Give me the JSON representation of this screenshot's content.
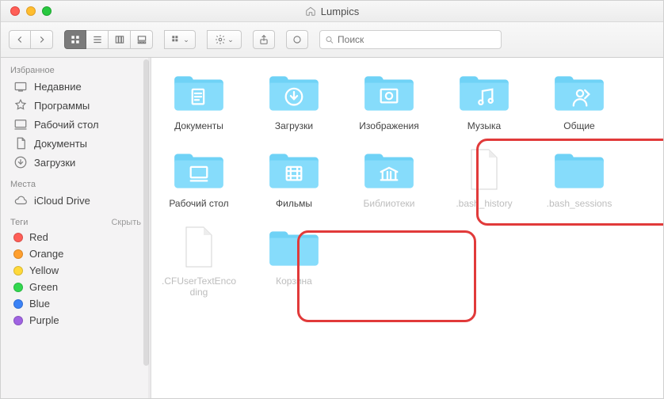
{
  "window": {
    "title": "Lumpics"
  },
  "search": {
    "placeholder": "Поиск"
  },
  "sidebar": {
    "favorites_header": "Избранное",
    "locations_header": "Места",
    "tags_header": "Теги",
    "hide_label": "Скрыть",
    "favorites": [
      {
        "label": "Недавние",
        "icon": "recent"
      },
      {
        "label": "Программы",
        "icon": "apps"
      },
      {
        "label": "Рабочий стол",
        "icon": "desktop"
      },
      {
        "label": "Документы",
        "icon": "docs"
      },
      {
        "label": "Загрузки",
        "icon": "downloads"
      }
    ],
    "locations": [
      {
        "label": "iCloud Drive",
        "icon": "cloud"
      }
    ],
    "tags": [
      {
        "label": "Red",
        "color": "#ff5e57"
      },
      {
        "label": "Orange",
        "color": "#ff9f2e"
      },
      {
        "label": "Yellow",
        "color": "#ffd93a"
      },
      {
        "label": "Green",
        "color": "#32d84f"
      },
      {
        "label": "Blue",
        "color": "#3b82f6"
      },
      {
        "label": "Purple",
        "color": "#a063e2"
      }
    ]
  },
  "items": [
    {
      "label": "Документы",
      "type": "folder",
      "glyph": "doc",
      "hidden": false
    },
    {
      "label": "Загрузки",
      "type": "folder",
      "glyph": "down",
      "hidden": false
    },
    {
      "label": "Изображения",
      "type": "folder",
      "glyph": "pic",
      "hidden": false
    },
    {
      "label": "Музыка",
      "type": "folder",
      "glyph": "music",
      "hidden": false
    },
    {
      "label": "Общие",
      "type": "folder",
      "glyph": "share",
      "hidden": false
    },
    {
      "label": "Рабочий стол",
      "type": "folder",
      "glyph": "desk",
      "hidden": false
    },
    {
      "label": "Фильмы",
      "type": "folder",
      "glyph": "film",
      "hidden": false
    },
    {
      "label": "Библиотеки",
      "type": "folder",
      "glyph": "lib",
      "hidden": true
    },
    {
      "label": ".bash_history",
      "type": "file",
      "hidden": true
    },
    {
      "label": ".bash_sessions",
      "type": "folder",
      "glyph": "none",
      "hidden": true
    },
    {
      "label": ".CFUserTextEncoding",
      "type": "file",
      "hidden": true
    },
    {
      "label": "Корзина",
      "type": "folder",
      "glyph": "none",
      "hidden": true
    }
  ]
}
